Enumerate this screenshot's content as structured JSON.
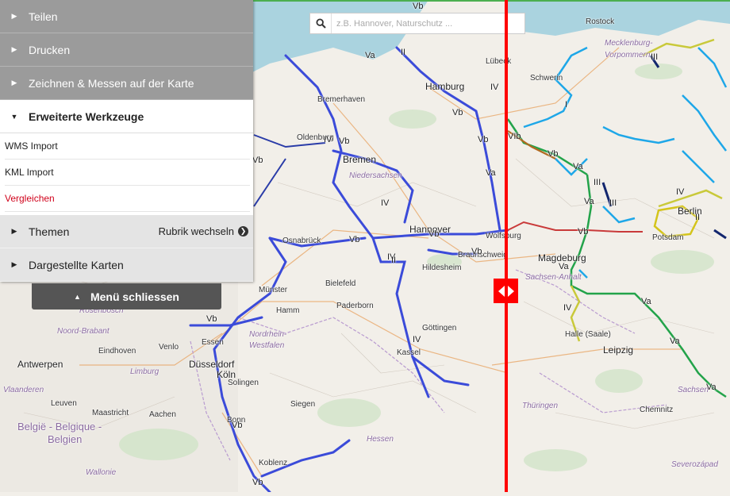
{
  "menu": {
    "items": [
      {
        "label": "Teilen"
      },
      {
        "label": "Drucken"
      },
      {
        "label": "Zeichnen & Messen auf der Karte"
      }
    ],
    "expanded": {
      "label": "Erweiterte Werkzeuge",
      "subitems": [
        {
          "label": "WMS Import"
        },
        {
          "label": "KML Import"
        },
        {
          "label": "Vergleichen"
        }
      ]
    },
    "themen": {
      "label": "Themen",
      "rubrik": "Rubrik wechseln"
    },
    "karten": {
      "label": "Dargestellte Karten"
    },
    "close_label": "Menü schliessen"
  },
  "search": {
    "placeholder": "z.B. Hannover, Naturschutz ..."
  },
  "map_labels": {
    "rostock": "Rostock",
    "mecklenburg": "Mecklenburg-",
    "vorpommern": "Vorpommern",
    "luebeck": "Lübeck",
    "hamburg": "Hamburg",
    "schwerin": "Schwerin",
    "bremerhaven": "Bremerhaven",
    "oldenburg": "Oldenburg",
    "bremen": "Bremen",
    "niedersachsen": "Niedersachsen",
    "berlin": "Berlin",
    "potsdam": "Potsdam",
    "hannover": "Hannover",
    "osnabrueck": "Osnabrück",
    "wolfsburg": "Wolfsburg",
    "braunschweig": "Braunschweig",
    "magdeburg": "Magdeburg",
    "hildesheim": "Hildesheim",
    "sachsen_anhalt": "Sachsen-Anhalt",
    "bielefeld": "Bielefeld",
    "muenster": "Münster",
    "hamm": "Hamm",
    "paderborn": "Paderborn",
    "goettingen": "Göttingen",
    "noord_brabant": "Noord-Brabant",
    "eindhoven": "Eindhoven",
    "venlo": "Venlo",
    "nrw1": "Nordrhein-",
    "nrw2": "Westfalen",
    "essen": "Essen",
    "kassel": "Kassel",
    "halle": "Halle (Saale)",
    "leipzig": "Leipzig",
    "antwerpen": "Antwerpen",
    "duesseldorf": "Düsseldorf",
    "limburg": "Limburg",
    "vlaanderen": "Vlaanderen",
    "koeln": "Köln",
    "solingen": "Solingen",
    "leuven": "Leuven",
    "maastricht": "Maastricht",
    "aachen": "Aachen",
    "siegen": "Siegen",
    "sachsen": "Sachsen",
    "belgie1": "België - Belgique -",
    "belgie2": "Belgien",
    "bonn": "Bonn",
    "thueringen": "Thüringen",
    "chemnitz": "Chemnitz",
    "hessen": "Hessen",
    "wallonie": "Wallonie",
    "koblenz": "Koblenz",
    "severozapad": "Severozápad",
    "rosenbosch": "Rosenbosch"
  },
  "roman_labels": [
    "Vb",
    "Va",
    "IV",
    "III",
    "II",
    "I",
    "Vb",
    "VIb",
    "Vb",
    "Va",
    "Va",
    "III",
    "III",
    "IV",
    "Vb",
    "IV",
    "Va",
    "Vb",
    "IV",
    "Vb",
    "Vb",
    "IV",
    "Vb",
    "Vb",
    "Vb",
    "Va",
    "Va",
    "IV",
    "Va",
    "Va",
    "Vb",
    "Vb",
    "Vb",
    "II",
    "IV",
    "II"
  ],
  "colors": {
    "divider": "#ff0000",
    "waterway": "#3b4bd9",
    "accent_red": "#d0021b",
    "menu_gray": "#9b9b9b"
  }
}
